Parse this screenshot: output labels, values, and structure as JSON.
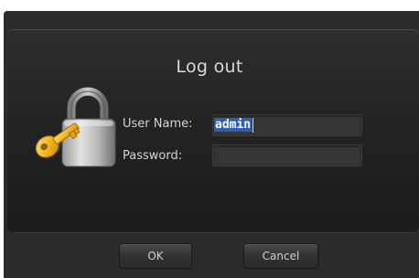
{
  "dialog": {
    "title": "Log out"
  },
  "form": {
    "user_name_label": "User Name:",
    "user_name_value": "admin",
    "password_label": "Password:",
    "password_value": ""
  },
  "buttons": {
    "ok_label": "OK",
    "cancel_label": "Cancel"
  },
  "icons": {
    "main": "padlock-key-icon"
  }
}
